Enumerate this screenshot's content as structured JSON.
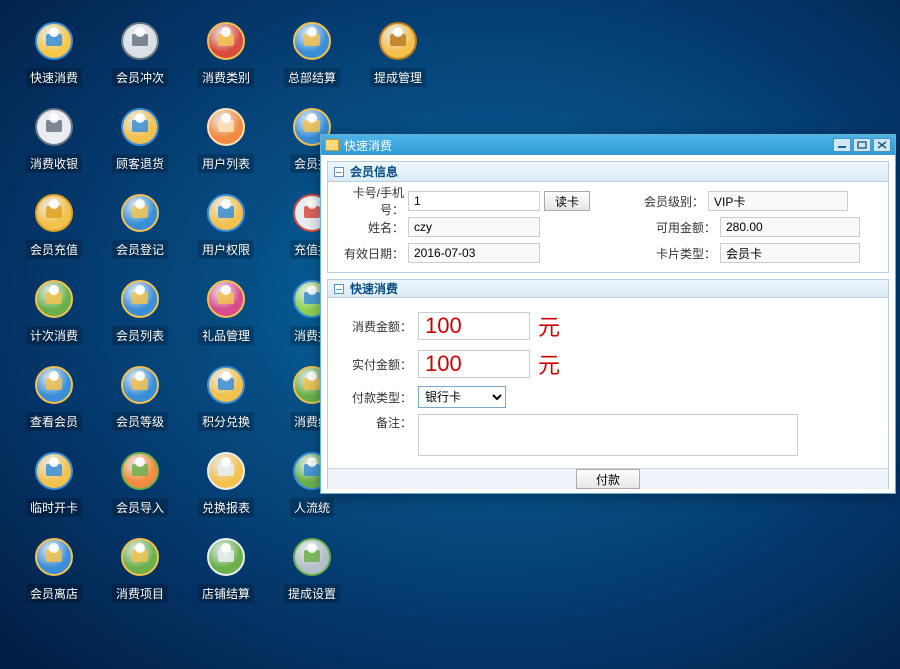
{
  "desktop": {
    "icons": [
      {
        "label": "快速消费",
        "icon": "fast-consume"
      },
      {
        "label": "会员冲次",
        "icon": "member-charge"
      },
      {
        "label": "消费类别",
        "icon": "consume-category"
      },
      {
        "label": "总部结算",
        "icon": "hq-settle"
      },
      {
        "label": "提成管理",
        "icon": "commission"
      },
      {
        "label": "消费收银",
        "icon": "cashier"
      },
      {
        "label": "顾客退货",
        "icon": "returns"
      },
      {
        "label": "用户列表",
        "icon": "user-list"
      },
      {
        "label": "会员报",
        "icon": "member-report"
      },
      {
        "label": "",
        "icon": "blank"
      },
      {
        "label": "会员充值",
        "icon": "member-topup"
      },
      {
        "label": "会员登记",
        "icon": "member-register"
      },
      {
        "label": "用户权限",
        "icon": "user-perms"
      },
      {
        "label": "充值报",
        "icon": "topup-report"
      },
      {
        "label": "",
        "icon": "blank"
      },
      {
        "label": "计次消费",
        "icon": "count-consume"
      },
      {
        "label": "会员列表",
        "icon": "member-list"
      },
      {
        "label": "礼品管理",
        "icon": "gifts"
      },
      {
        "label": "消费报",
        "icon": "consume-report"
      },
      {
        "label": "",
        "icon": "blank"
      },
      {
        "label": "查看会员",
        "icon": "view-member"
      },
      {
        "label": "会员等级",
        "icon": "member-level"
      },
      {
        "label": "积分兑换",
        "icon": "points"
      },
      {
        "label": "消费统",
        "icon": "consume-stat"
      },
      {
        "label": "",
        "icon": "blank"
      },
      {
        "label": "临时开卡",
        "icon": "temp-card"
      },
      {
        "label": "会员导入",
        "icon": "member-import"
      },
      {
        "label": "兑换报表",
        "icon": "exchange-report"
      },
      {
        "label": "人流统",
        "icon": "traffic"
      },
      {
        "label": "",
        "icon": "blank"
      },
      {
        "label": "会员离店",
        "icon": "member-leave"
      },
      {
        "label": "消费项目",
        "icon": "consume-item"
      },
      {
        "label": "店铺结算",
        "icon": "shop-settle"
      },
      {
        "label": "提成设置",
        "icon": "commission-set"
      }
    ]
  },
  "window": {
    "title": "快速消费",
    "panel1": {
      "title": "会员信息",
      "card_label": "卡号/手机号：",
      "card_value": "1",
      "read_btn": "读卡",
      "level_label": "会员级别：",
      "level_value": "VIP卡",
      "name_label": "姓名：",
      "name_value": "czy",
      "balance_label": "可用金额：",
      "balance_value": "280.00",
      "expire_label": "有效日期：",
      "expire_value": "2016-07-03",
      "cardtype_label": "卡片类型：",
      "cardtype_value": "会员卡"
    },
    "panel2": {
      "title": "快速消费",
      "consume_label": "消费金额：",
      "consume_value": "100",
      "consume_unit": "元",
      "actual_label": "实付金额：",
      "actual_value": "100",
      "actual_unit": "元",
      "paytype_label": "付款类型：",
      "paytype_value": "银行卡",
      "remark_label": "备注：",
      "remark_value": "",
      "pay_btn": "付款"
    }
  }
}
